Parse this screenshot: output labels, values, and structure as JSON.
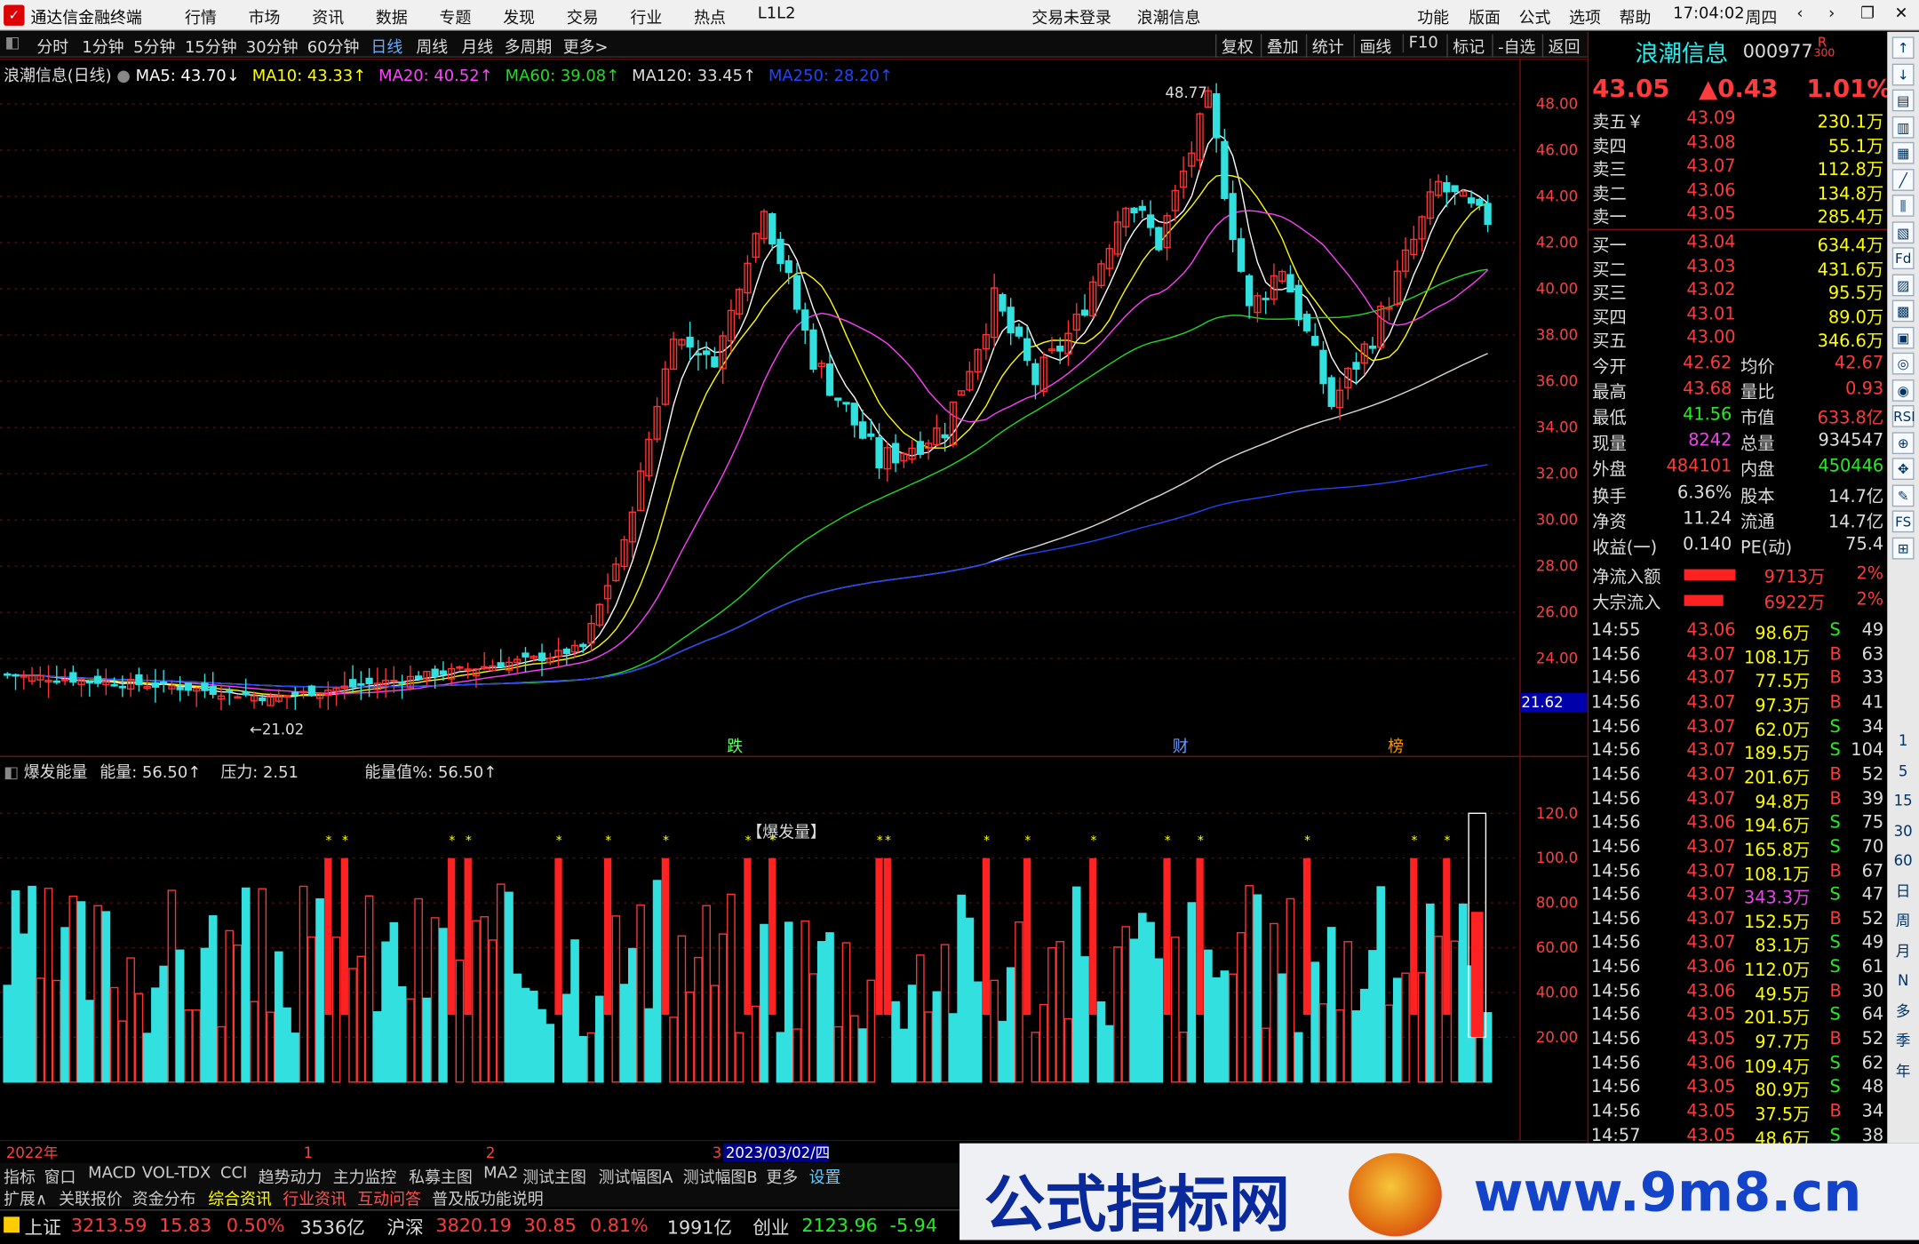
{
  "app": {
    "title": "通达信金融终端",
    "menu": [
      "行情",
      "市场",
      "资讯",
      "数据",
      "专题",
      "发现",
      "交易",
      "行业",
      "热点",
      "L1L2"
    ],
    "center_status": [
      "交易未登录",
      "浪潮信息"
    ],
    "right_menu": [
      "功能",
      "版面",
      "公式",
      "选项",
      "帮助"
    ],
    "time": "17:04:02",
    "weekday": "周四",
    "window_controls": [
      "‹",
      "›",
      "❐",
      "—",
      "□",
      "✕"
    ]
  },
  "toolbar": {
    "periods": [
      "分时",
      "1分钟",
      "5分钟",
      "15分钟",
      "30分钟",
      "60分钟",
      "日线",
      "周线",
      "月线",
      "多周期",
      "更多>"
    ],
    "selected": "日线",
    "right_buttons": [
      "复权",
      "叠加",
      "统计",
      "画线",
      "F10",
      "标记",
      "-自选",
      "返回"
    ]
  },
  "stock": {
    "name": "浪潮信息",
    "code": "000977",
    "badge": "R",
    "badge_sub": "300",
    "price": "43.05",
    "change": "▲0.43",
    "pct": "1.01%"
  },
  "main_chart": {
    "title": "浪潮信息(日线)",
    "ma": [
      {
        "label": "MA5: 43.70↓",
        "color": "#ffffff"
      },
      {
        "label": "MA10: 43.33↑",
        "color": "#ffff00"
      },
      {
        "label": "MA20: 40.52↑",
        "color": "#ff40ff"
      },
      {
        "label": "MA60: 39.08↑",
        "color": "#22dd22"
      },
      {
        "label": "MA120: 33.45↑",
        "color": "#dddddd"
      },
      {
        "label": "MA250: 28.20↑",
        "color": "#2244ff"
      }
    ],
    "high_label": "48.77",
    "low_label": "21.02",
    "price_marker": "21.62",
    "yaxis": [
      "48.00",
      "46.00",
      "44.00",
      "42.00",
      "40.00",
      "38.00",
      "36.00",
      "34.00",
      "32.00",
      "30.00",
      "28.00",
      "26.00",
      "24.00"
    ],
    "markers": [
      "跌",
      "财",
      "榜"
    ]
  },
  "indicator": {
    "title": "爆发能量",
    "energy": "能量: 56.50↑",
    "pressure": "压力: 2.51",
    "value": "能量值%: 56.50↑",
    "label": "【爆发量】",
    "yaxis": [
      "120.0",
      "100.0",
      "80.00",
      "60.00",
      "40.00",
      "20.00"
    ]
  },
  "xaxis": {
    "labels": [
      "2022年",
      "1",
      "2",
      "3"
    ],
    "cursor_date": "2023/03/02/四"
  },
  "orderbook": {
    "asks": [
      {
        "label": "卖五￥",
        "price": "43.09",
        "vol": "230.1万"
      },
      {
        "label": "卖四",
        "price": "43.08",
        "vol": "55.1万"
      },
      {
        "label": "卖三",
        "price": "43.07",
        "vol": "112.8万"
      },
      {
        "label": "卖二",
        "price": "43.06",
        "vol": "134.8万"
      },
      {
        "label": "卖一",
        "price": "43.05",
        "vol": "285.4万"
      }
    ],
    "bids": [
      {
        "label": "买一",
        "price": "43.04",
        "vol": "634.4万"
      },
      {
        "label": "买二",
        "price": "43.03",
        "vol": "431.6万"
      },
      {
        "label": "买三",
        "price": "43.02",
        "vol": "95.5万"
      },
      {
        "label": "买四",
        "price": "43.01",
        "vol": "89.0万"
      },
      {
        "label": "买五",
        "price": "43.00",
        "vol": "346.6万"
      }
    ]
  },
  "stats": [
    {
      "l1": "今开",
      "v1": "42.62",
      "l2": "均价",
      "v2": "42.67"
    },
    {
      "l1": "最高",
      "v1": "43.68",
      "l2": "量比",
      "v2": "0.93"
    },
    {
      "l1": "最低",
      "v1": "41.56",
      "l2": "市值",
      "v2": "633.8亿"
    },
    {
      "l1": "现量",
      "v1": "8242",
      "l2": "总量",
      "v2": "934547"
    },
    {
      "l1": "外盘",
      "v1": "484101",
      "l2": "内盘",
      "v2": "450446"
    }
  ],
  "stats2": [
    {
      "l1": "换手",
      "v1": "6.36%",
      "l2": "股本",
      "v2": "14.7亿"
    },
    {
      "l1": "净资",
      "v1": "11.24",
      "l2": "流通",
      "v2": "14.7亿"
    },
    {
      "l1": "收益(一)",
      "v1": "0.140",
      "l2": "PE(动)",
      "v2": "75.4"
    }
  ],
  "flows": [
    {
      "label": "净流入额",
      "value": "9713万",
      "pct": "2%",
      "fill": 0.6
    },
    {
      "label": "大宗流入",
      "value": "6922万",
      "pct": "2%",
      "fill": 0.45
    }
  ],
  "ticks": [
    [
      "14:55",
      "43.06",
      "98.6万",
      "S",
      "49"
    ],
    [
      "14:56",
      "43.07",
      "108.1万",
      "B",
      "63"
    ],
    [
      "14:56",
      "43.07",
      "77.5万",
      "B",
      "33"
    ],
    [
      "14:56",
      "43.07",
      "97.3万",
      "B",
      "41"
    ],
    [
      "14:56",
      "43.07",
      "62.0万",
      "S",
      "34"
    ],
    [
      "14:56",
      "43.07",
      "189.5万",
      "S",
      "104"
    ],
    [
      "14:56",
      "43.07",
      "201.6万",
      "B",
      "52"
    ],
    [
      "14:56",
      "43.07",
      "94.8万",
      "B",
      "39"
    ],
    [
      "14:56",
      "43.06",
      "194.6万",
      "S",
      "75"
    ],
    [
      "14:56",
      "43.07",
      "165.8万",
      "S",
      "70"
    ],
    [
      "14:56",
      "43.07",
      "108.1万",
      "B",
      "67"
    ],
    [
      "14:56",
      "43.07",
      "343.3万",
      "S",
      "47"
    ],
    [
      "14:56",
      "43.07",
      "152.5万",
      "B",
      "52"
    ],
    [
      "14:56",
      "43.07",
      "83.1万",
      "S",
      "49"
    ],
    [
      "14:56",
      "43.06",
      "112.0万",
      "S",
      "61"
    ],
    [
      "14:56",
      "43.06",
      "49.5万",
      "B",
      "30"
    ],
    [
      "14:56",
      "43.05",
      "201.5万",
      "S",
      "64"
    ],
    [
      "14:56",
      "43.05",
      "97.7万",
      "B",
      "52"
    ],
    [
      "14:56",
      "43.06",
      "109.4万",
      "S",
      "62"
    ],
    [
      "14:56",
      "43.05",
      "80.9万",
      "S",
      "48"
    ],
    [
      "14:56",
      "43.05",
      "37.5万",
      "B",
      "34"
    ],
    [
      "14:57",
      "43.05",
      "48.6万",
      "S",
      "38"
    ]
  ],
  "sidebar_icons": [
    "↑",
    "↓",
    "▤",
    "▥",
    "▦",
    "╱",
    "⫼",
    "▧",
    "Fd",
    "▨",
    "▩",
    "▣",
    "◎",
    "◉",
    "RSI",
    "⊕",
    "✥",
    "✎",
    "FS",
    "⊞"
  ],
  "sidebar_labels": [
    "1",
    "5",
    "15",
    "30",
    "60",
    "日",
    "周",
    "月",
    "N",
    "多",
    "季",
    "年"
  ],
  "bottom_tabs": [
    "指标",
    "窗口",
    "MACD",
    "VOL-TDX",
    "CCI",
    "趋势动力",
    "主力监控",
    "私募主图",
    "MA2",
    "测试主图",
    "测试幅图A",
    "测试幅图B",
    "更多",
    "设置"
  ],
  "bottom_tabs2": [
    "扩展∧",
    "关联报价",
    "资金分布",
    "综合资讯",
    "行业资讯",
    "互动问答",
    "普及版功能说明"
  ],
  "status": [
    {
      "name": "上证",
      "v": "3213.59",
      "c": "15.83",
      "p": "0.50%",
      "a": "3536亿"
    },
    {
      "name": "沪深",
      "v": "3820.19",
      "c": "30.85",
      "p": "0.81%",
      "a": "1991亿"
    },
    {
      "name": "创业",
      "v": "2123.96",
      "c": "-5.94",
      "p": "",
      "a": ""
    }
  ],
  "watermark": {
    "text": "公式指标网",
    "url": "www.9m8.cn"
  },
  "colors": {
    "up": "#ff3333",
    "down": "#33e0e0",
    "bg": "#000000",
    "grid": "#7a1010"
  }
}
